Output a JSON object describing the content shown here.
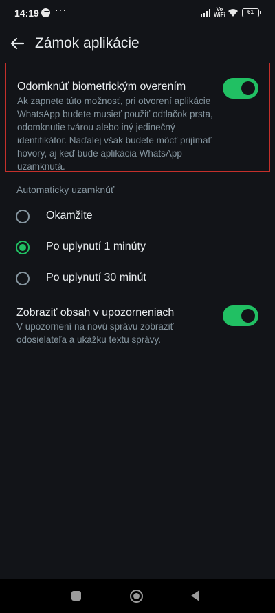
{
  "status_bar": {
    "time": "14:19",
    "overflow": "···",
    "volte_top": "Vo",
    "volte_bottom": "WiFi",
    "battery": "61",
    "icons": [
      "messenger-icon",
      "signal-icon",
      "wifi-icon",
      "battery-icon"
    ]
  },
  "app_bar": {
    "title": "Zámok aplikácie",
    "back_icon": "arrow-left-icon"
  },
  "biometric": {
    "title": "Odomknúť biometrickým overením",
    "description": "Ak zapnete túto možnosť, pri otvorení aplikácie WhatsApp budete musieť použiť odtlačok prsta, odomknutie tvárou alebo iný jedinečný identifikátor. Naďalej však budete môcť prijímať hovory, aj keď bude aplikácia WhatsApp uzamknutá.",
    "enabled": true
  },
  "auto_lock": {
    "header": "Automaticky uzamknúť",
    "options": [
      {
        "label": "Okamžite",
        "selected": false
      },
      {
        "label": "Po uplynutí 1 minúty",
        "selected": true
      },
      {
        "label": "Po uplynutí 30 minút",
        "selected": false
      }
    ]
  },
  "notifications": {
    "title": "Zobraziť obsah v upozorneniach",
    "description": "V upozornení na novú správu zobraziť odosielateľa a ukážku textu správy.",
    "enabled": true
  },
  "colors": {
    "background": "#121418",
    "accent": "#21c063",
    "primary_text": "#e9edef",
    "secondary_text": "#8696a0",
    "highlight_border": "#c4302b"
  },
  "nav_bar": {
    "icons": [
      "recents-square-icon",
      "home-circle-icon",
      "back-triangle-icon"
    ]
  }
}
